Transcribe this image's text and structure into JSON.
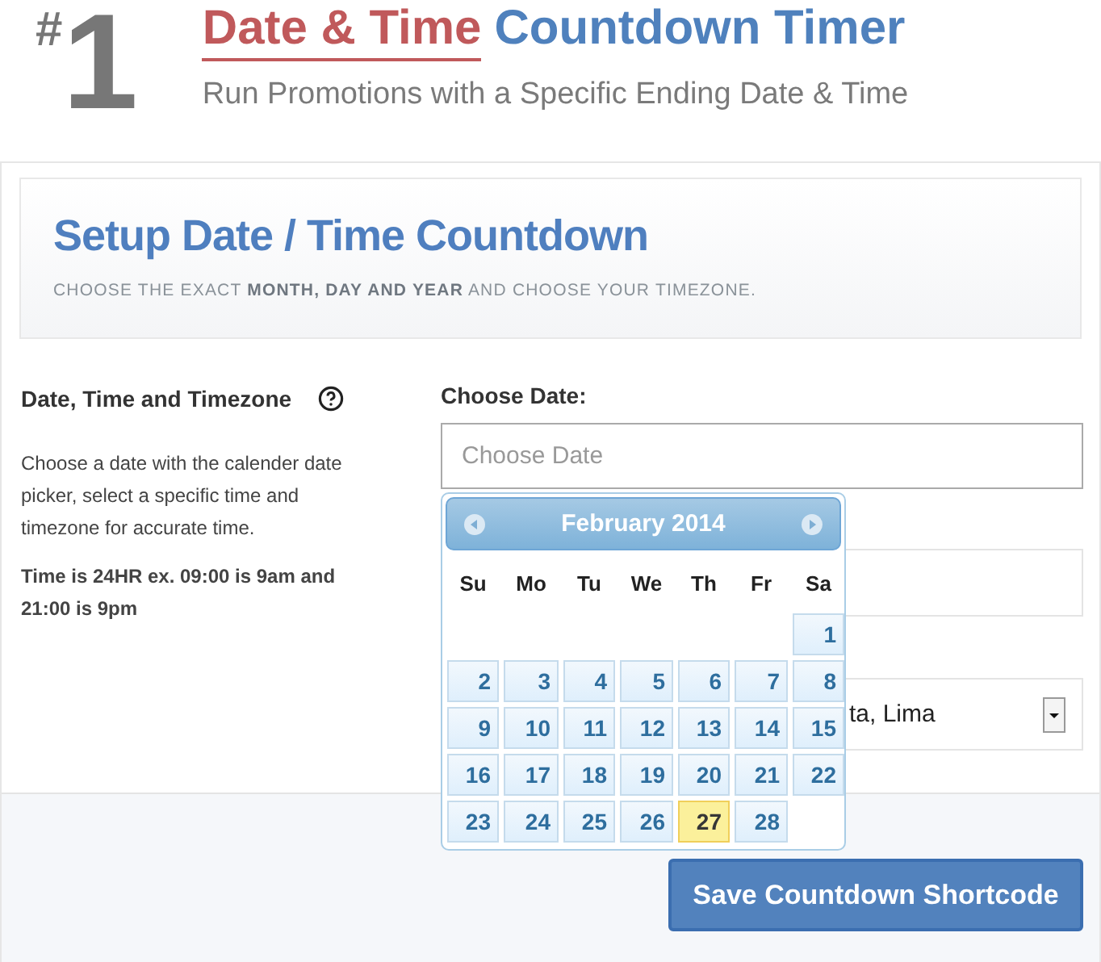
{
  "header": {
    "number_mark": "#",
    "number": "1",
    "title_highlight": "Date & Time",
    "title_rest": "Countdown Timer",
    "subtitle": "Run Promotions with a Specific Ending Date & Time"
  },
  "setup": {
    "title": "Setup Date / Time Countdown",
    "subtitle": "CHOOSE THE EXACT **MONTH, DAY AND YEAR** AND CHOOSE YOUR TIMEZONE."
  },
  "help": {
    "heading": "Date, Time and Timezone",
    "description": "Choose a date with the calender date picker, select a specific time and timezone for accurate time.",
    "note": "Time is 24HR ex. 09:00 is 9am and 21:00 is 9pm"
  },
  "date_field": {
    "label": "Choose Date:",
    "placeholder": "Choose Date"
  },
  "timezone_select": {
    "value": "ta, Lima"
  },
  "calendar": {
    "month": "February 2014",
    "weekdays": [
      "Su",
      "Mo",
      "Tu",
      "We",
      "Th",
      "Fr",
      "Sa"
    ],
    "days": [
      {
        "label": "1",
        "selected": false
      },
      {
        "label": "2",
        "selected": false
      },
      {
        "label": "3",
        "selected": false
      },
      {
        "label": "4",
        "selected": false
      },
      {
        "label": "5",
        "selected": false
      },
      {
        "label": "6",
        "selected": false
      },
      {
        "label": "7",
        "selected": false
      },
      {
        "label": "8",
        "selected": false
      },
      {
        "label": "9",
        "selected": false
      },
      {
        "label": "10",
        "selected": false
      },
      {
        "label": "11",
        "selected": false
      },
      {
        "label": "12",
        "selected": false
      },
      {
        "label": "13",
        "selected": false
      },
      {
        "label": "14",
        "selected": false
      },
      {
        "label": "15",
        "selected": false
      },
      {
        "label": "16",
        "selected": false
      },
      {
        "label": "17",
        "selected": false
      },
      {
        "label": "18",
        "selected": false
      },
      {
        "label": "19",
        "selected": false
      },
      {
        "label": "20",
        "selected": false
      },
      {
        "label": "21",
        "selected": false
      },
      {
        "label": "22",
        "selected": false
      },
      {
        "label": "23",
        "selected": false
      },
      {
        "label": "24",
        "selected": false
      },
      {
        "label": "25",
        "selected": false
      },
      {
        "label": "26",
        "selected": false
      },
      {
        "label": "27",
        "selected": true
      },
      {
        "label": "28",
        "selected": false
      }
    ]
  },
  "save_button": "Save Countdown Shortcode"
}
